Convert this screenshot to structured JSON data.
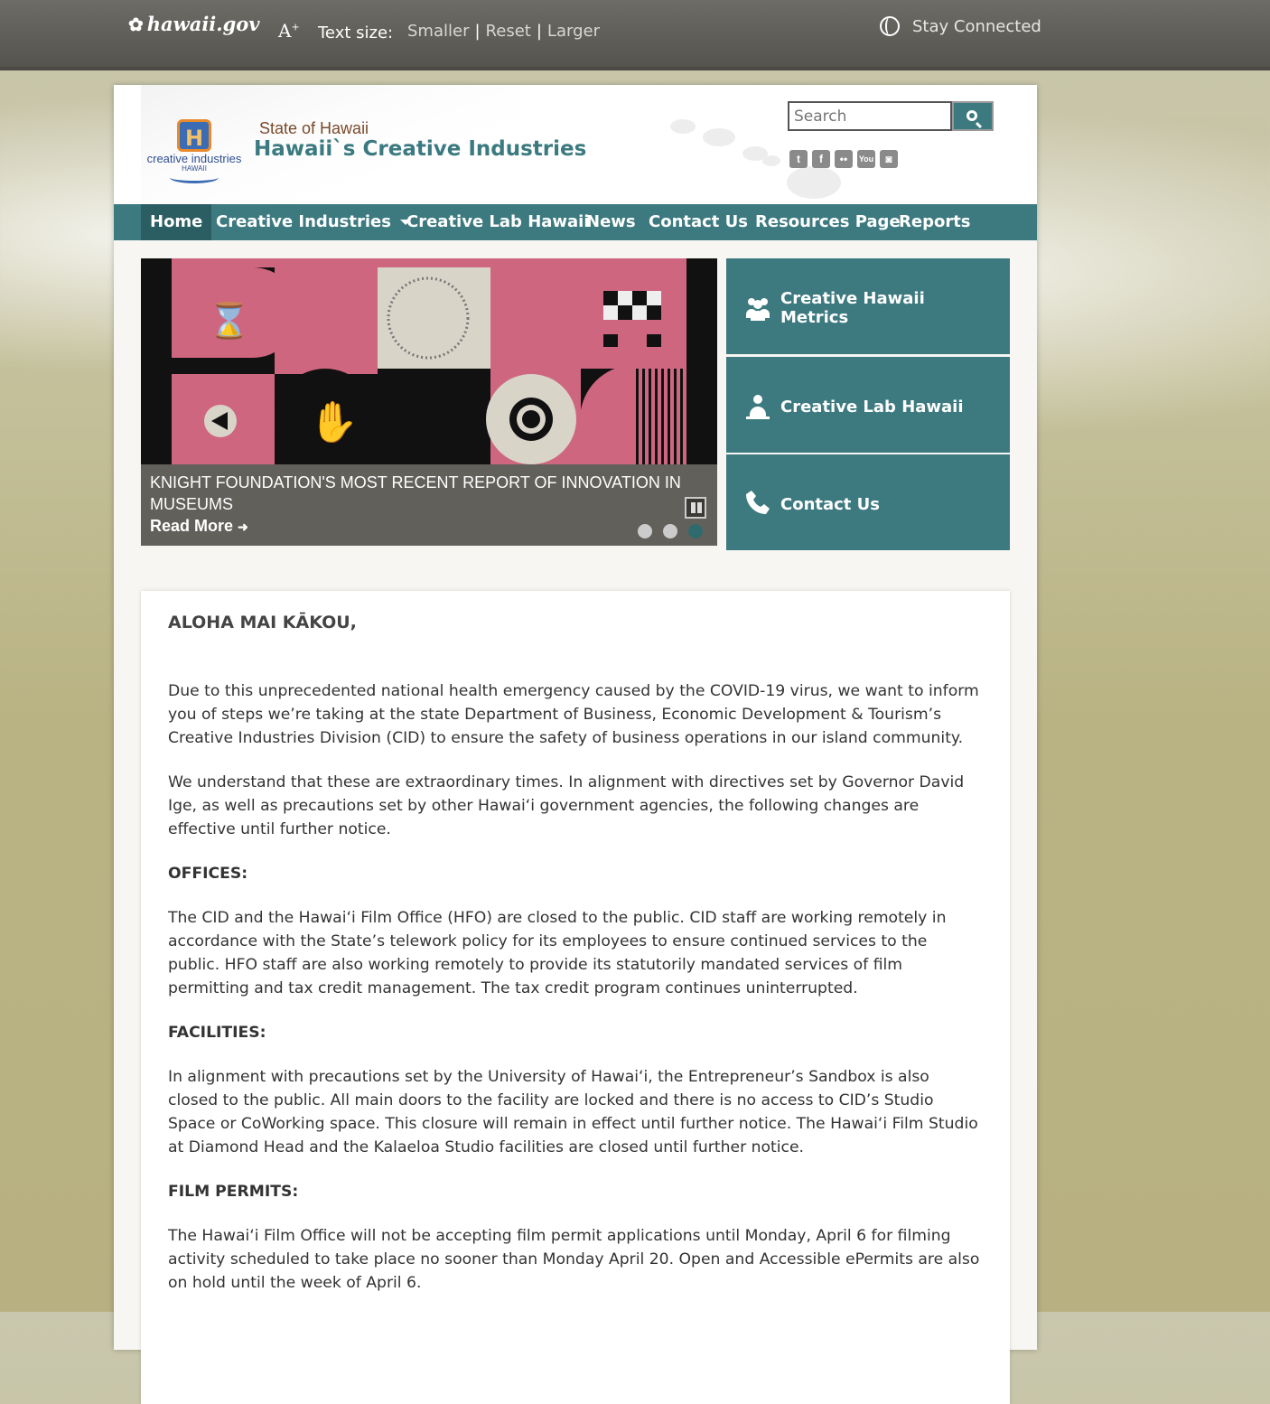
{
  "topbar": {
    "gov_logo": "hawaii.gov",
    "text_size_label": "Text size:",
    "smaller": "Smaller",
    "reset": "Reset",
    "larger": "Larger",
    "sep": "|",
    "stay_connected": "Stay Connected"
  },
  "header": {
    "logo_main": "creative industries",
    "logo_sub": "HAWAII",
    "state_label": "State of Hawaii",
    "site_title": "Hawaii`s Creative Industries",
    "search_placeholder": "Search",
    "social": [
      "twitter-icon",
      "facebook-icon",
      "flickr-icon",
      "youtube-icon",
      "instagram-icon"
    ]
  },
  "nav": {
    "items": [
      "Home",
      "Creative Industries",
      "Creative Lab Hawaii",
      "News",
      "Contact Us",
      "Resources Page",
      "Reports"
    ],
    "active": "Home"
  },
  "slider": {
    "caption": "KNIGHT FOUNDATION'S MOST RECENT REPORT OF INNOVATION IN MUSEUMS",
    "read_more": "Read More",
    "slides": 3,
    "active_slide": 3
  },
  "tiles": [
    {
      "label": "Creative Hawaii Metrics",
      "icon": "people-icon"
    },
    {
      "label": "Creative Lab Hawaii",
      "icon": "person-icon"
    },
    {
      "label": "Contact Us",
      "icon": "phone-icon"
    }
  ],
  "content": {
    "heading": "ALOHA MAI KĀKOU,",
    "p1": "Due to this unprecedented national health emergency caused by the COVID-19 virus, we want to inform you of steps we’re taking at the state Department of Business, Economic Development & Tourism’s Creative Industries Division (CID) to ensure the safety of business operations in our island community.",
    "p2": "We understand that these are extraordinary times. In alignment with directives set by Governor David Ige, as well as precautions set by other Hawai‘i government agencies, the following changes are effective until further notice.",
    "offices_title": "OFFICES:",
    "offices_text": "The CID and the Hawai‘i Film Office (HFO) are closed to the public. CID staff are working remotely in accordance with the State’s telework policy for its employees to ensure continued services to the public. HFO staff are also working remotely to provide its statutorily mandated services of film permitting and tax credit management. The tax credit program continues uninterrupted.",
    "facilities_title": "FACILITIES:",
    "facilities_text": "In alignment with precautions set by the University of Hawai‘i, the Entrepreneur’s Sandbox is also closed to the public. All main doors to the facility are locked and there is no access to CID’s Studio Space or CoWorking space. This closure will remain in effect until further notice. The Hawai‘i Film Studio at Diamond Head and the Kalaeloa Studio facilities are closed until further notice.",
    "permits_title": "FILM PERMITS:",
    "permits_text": "The Hawai‘i Film Office will not be accepting film permit applications until Monday, April 6 for filming activity scheduled to take place no sooner than Monday April 20. Open and Accessible ePermits are also on hold until the week of April 6."
  },
  "colors": {
    "teal": "#3d7a80",
    "teal_dark": "#2b5e63",
    "topbar": "#5e5d57",
    "pink": "#cf6680"
  }
}
